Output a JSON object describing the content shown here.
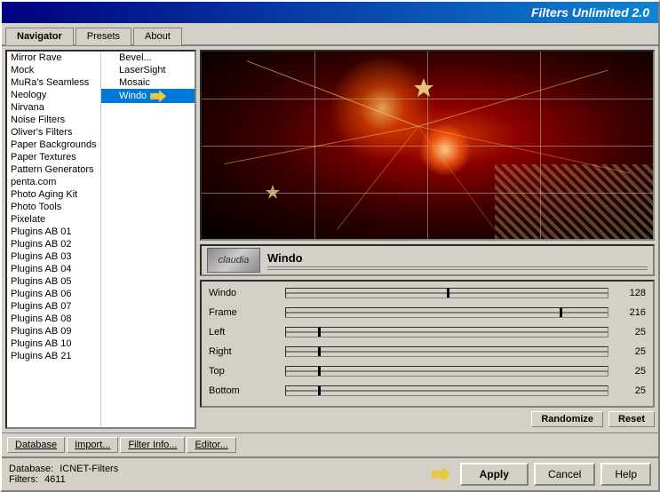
{
  "title": "Filters Unlimited 2.0",
  "tabs": [
    {
      "label": "Navigator",
      "active": true
    },
    {
      "label": "Presets",
      "active": false
    },
    {
      "label": "About",
      "active": false
    }
  ],
  "left_list": {
    "items": [
      {
        "label": "Mirror Rave",
        "selected": false,
        "hasArrow": true
      },
      {
        "label": "Mock",
        "selected": false,
        "hasArrow": true
      },
      {
        "label": "MuRa's Seamless",
        "selected": false
      },
      {
        "label": "Neology",
        "selected": false
      },
      {
        "label": "Nirvana",
        "selected": false
      },
      {
        "label": "Noise Filters",
        "selected": false
      },
      {
        "label": "Oliver's Filters",
        "selected": false
      },
      {
        "label": "Paper Backgrounds",
        "selected": false
      },
      {
        "label": "Paper Textures",
        "selected": false
      },
      {
        "label": "Pattern Generators",
        "selected": false
      },
      {
        "label": "penta.com",
        "selected": false
      },
      {
        "label": "Photo Aging Kit",
        "selected": false
      },
      {
        "label": "Photo Tools",
        "selected": false
      },
      {
        "label": "Pixelate",
        "selected": false
      },
      {
        "label": "Plugins AB 01",
        "selected": false
      },
      {
        "label": "Plugins AB 02",
        "selected": false
      },
      {
        "label": "Plugins AB 03",
        "selected": false
      },
      {
        "label": "Plugins AB 04",
        "selected": false
      },
      {
        "label": "Plugins AB 05",
        "selected": false
      },
      {
        "label": "Plugins AB 06",
        "selected": false
      },
      {
        "label": "Plugins AB 07",
        "selected": false
      },
      {
        "label": "Plugins AB 08",
        "selected": false
      },
      {
        "label": "Plugins AB 09",
        "selected": false
      },
      {
        "label": "Plugins AB 10",
        "selected": false
      },
      {
        "label": "Plugins AB 21",
        "selected": false
      }
    ],
    "sub_items": [
      {
        "label": "Bevel...",
        "selected": false
      },
      {
        "label": "LaserSight",
        "selected": false
      },
      {
        "label": "Mosaic",
        "selected": false
      },
      {
        "label": "Windo",
        "selected": true,
        "hasArrow": true
      }
    ]
  },
  "filter_logo": "claudia",
  "filter_name": "Windo",
  "params": [
    {
      "label": "Windo",
      "value": 128,
      "percent": 50
    },
    {
      "label": "Frame",
      "value": 216,
      "percent": 85
    },
    {
      "label": "Left",
      "value": 25,
      "percent": 10
    },
    {
      "label": "Right",
      "value": 25,
      "percent": 10
    },
    {
      "label": "Top",
      "value": 25,
      "percent": 10
    },
    {
      "label": "Bottom",
      "value": 25,
      "percent": 10
    }
  ],
  "toolbar": {
    "database": "Database",
    "import": "Import...",
    "filter_info": "Filter Info...",
    "editor": "Editor...",
    "randomize": "Randomize",
    "reset": "Reset"
  },
  "status": {
    "database_label": "Database:",
    "database_value": "ICNET-Filters",
    "filters_label": "Filters:",
    "filters_value": "4611"
  },
  "actions": {
    "apply": "Apply",
    "cancel": "Cancel",
    "help": "Help"
  }
}
